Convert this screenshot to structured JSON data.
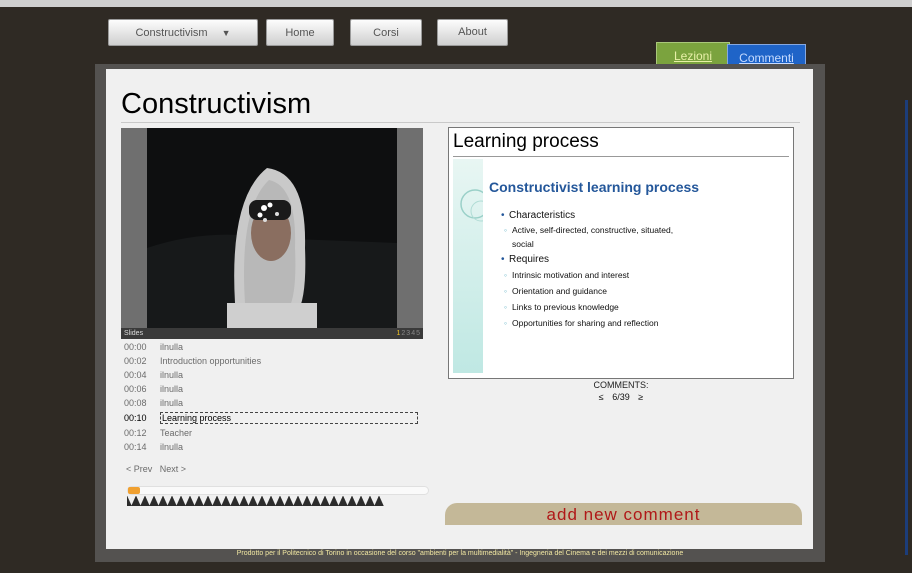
{
  "nav": {
    "items": [
      {
        "label": "Constructivism",
        "dropdown": true
      },
      {
        "label": "Home"
      },
      {
        "label": "Corsi"
      },
      {
        "label": "About"
      }
    ]
  },
  "tabs": {
    "lezioni": "Lezioni",
    "commenti": "Commenti"
  },
  "page_title": "Constructivism",
  "video": {
    "slides_label": "Slides",
    "slide_numbers": [
      "1",
      "2",
      "3",
      "4",
      "5"
    ],
    "active_slide_number": "1"
  },
  "chapters": [
    {
      "time": "00:00",
      "title": "ilnulla"
    },
    {
      "time": "00:02",
      "title": "Introduction opportunities"
    },
    {
      "time": "00:04",
      "title": "ilnulla"
    },
    {
      "time": "00:06",
      "title": "ilnulla"
    },
    {
      "time": "00:08",
      "title": "ilnulla"
    },
    {
      "time": "00:10",
      "title": "Learning process",
      "active": true
    },
    {
      "time": "00:12",
      "title": "Teacher"
    },
    {
      "time": "00:14",
      "title": "ilnulla"
    }
  ],
  "player": {
    "prev_label": "< Prev",
    "next_label": "Next >",
    "progress_fraction": 0.04
  },
  "slide": {
    "heading": "Learning process",
    "content_title": "Constructivist learning process",
    "bullets": [
      {
        "level": 1,
        "text": "Characteristics"
      },
      {
        "level": 2,
        "text": "Active, self-directed, constructive, situated,"
      },
      {
        "level": 2,
        "text": "social",
        "continuation": true
      },
      {
        "level": 1,
        "text": "Requires"
      },
      {
        "level": 2,
        "text": "Intrinsic motivation and interest"
      },
      {
        "level": 2,
        "text": "Orientation and guidance"
      },
      {
        "level": 2,
        "text": "Links to previous knowledge"
      },
      {
        "level": 2,
        "text": "Opportunities for sharing and reflection"
      }
    ],
    "prev_symbol": "≤",
    "page": "6/39",
    "next_symbol": "≥"
  },
  "comments": {
    "label": "COMMENTS:",
    "add_button": "add new comment"
  },
  "footer": "Prodotto per il Politecnico di Torino in occasione del corso \"ambienti per la multimedialità\" - Ingegneria del Cinema e dei mezzi di comunicazione"
}
